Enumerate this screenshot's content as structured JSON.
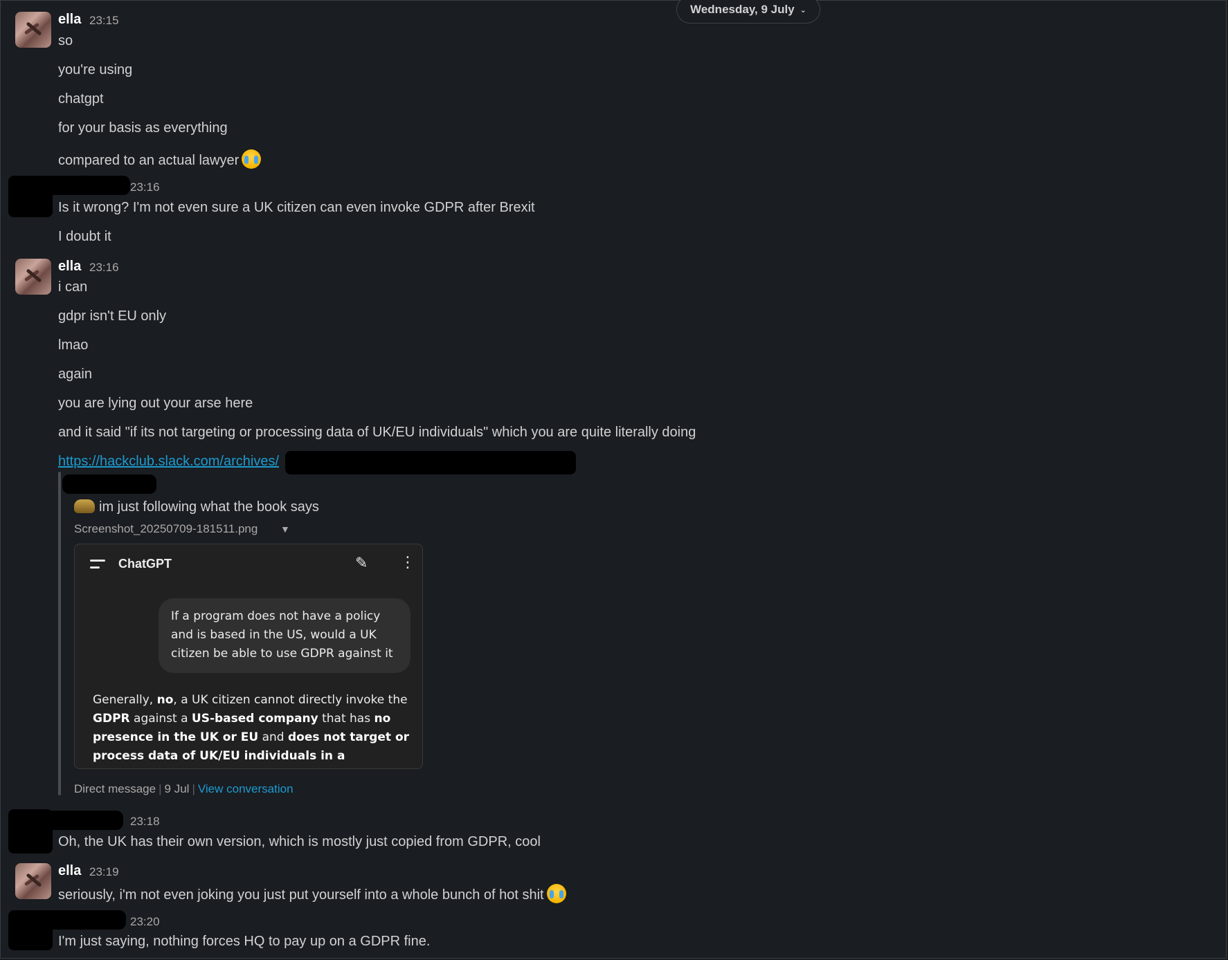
{
  "date_divider": {
    "label": "Wednesday, 9 July",
    "chevron": "chevron-down-icon"
  },
  "messages": {
    "m1": {
      "author": "ella",
      "time": "23:15",
      "lines": [
        "so",
        "you're using",
        "chatgpt",
        "for your basis as everything",
        "compared to an actual lawyer"
      ]
    },
    "m2": {
      "time": "23:16",
      "lines": [
        "Is it wrong? I'm not even sure a UK citizen can even invoke GDPR after Brexit",
        "I doubt it"
      ]
    },
    "m3": {
      "author": "ella",
      "time": "23:16",
      "lines": [
        "i can",
        "gdpr isn't EU only",
        "lmao",
        "again",
        "you are lying out your arse here",
        "and it said \"if its not targeting or processing data of UK/EU individuals\" which you are quite literally doing"
      ],
      "link": "https://hackclub.slack.com/archives/"
    },
    "m4": {
      "time": "23:18",
      "lines": [
        "Oh, the UK has their own version, which is mostly just copied from GDPR, cool"
      ]
    },
    "m5": {
      "author": "ella",
      "time": "23:19",
      "lines": [
        "seriously, i'm not even joking you just put yourself into a whole bunch of hot shit"
      ]
    },
    "m6": {
      "time": "23:20",
      "lines": [
        "I'm just saying, nothing forces HQ to pay up on a GDPR fine."
      ]
    }
  },
  "quoted": {
    "text": "im just following what the book says",
    "attachment_name": "Screenshot_20250709-181511.png",
    "footer": {
      "source": "Direct message",
      "date": "9 Jul",
      "view_label": "View conversation"
    },
    "screenshot": {
      "title": "ChatGPT",
      "user_prompt": "If a program does not have a policy and is based in the US, would a UK citizen be able to use GDPR against it",
      "answer": {
        "p1": "Generally, ",
        "b1": "no",
        "p2": ", a UK citizen cannot directly invoke the ",
        "b2": "GDPR",
        "p3": " against a ",
        "b3": "US-based company",
        "p4": " that has ",
        "b4": "no presence in the UK or EU",
        "p5": " and ",
        "b5": "does not target or process data of UK/EU individuals in a"
      }
    }
  },
  "colors": {
    "background": "#1a1d21",
    "text": "#d1d2d3",
    "link": "#1d9bd1",
    "muted": "#aba9a9"
  }
}
